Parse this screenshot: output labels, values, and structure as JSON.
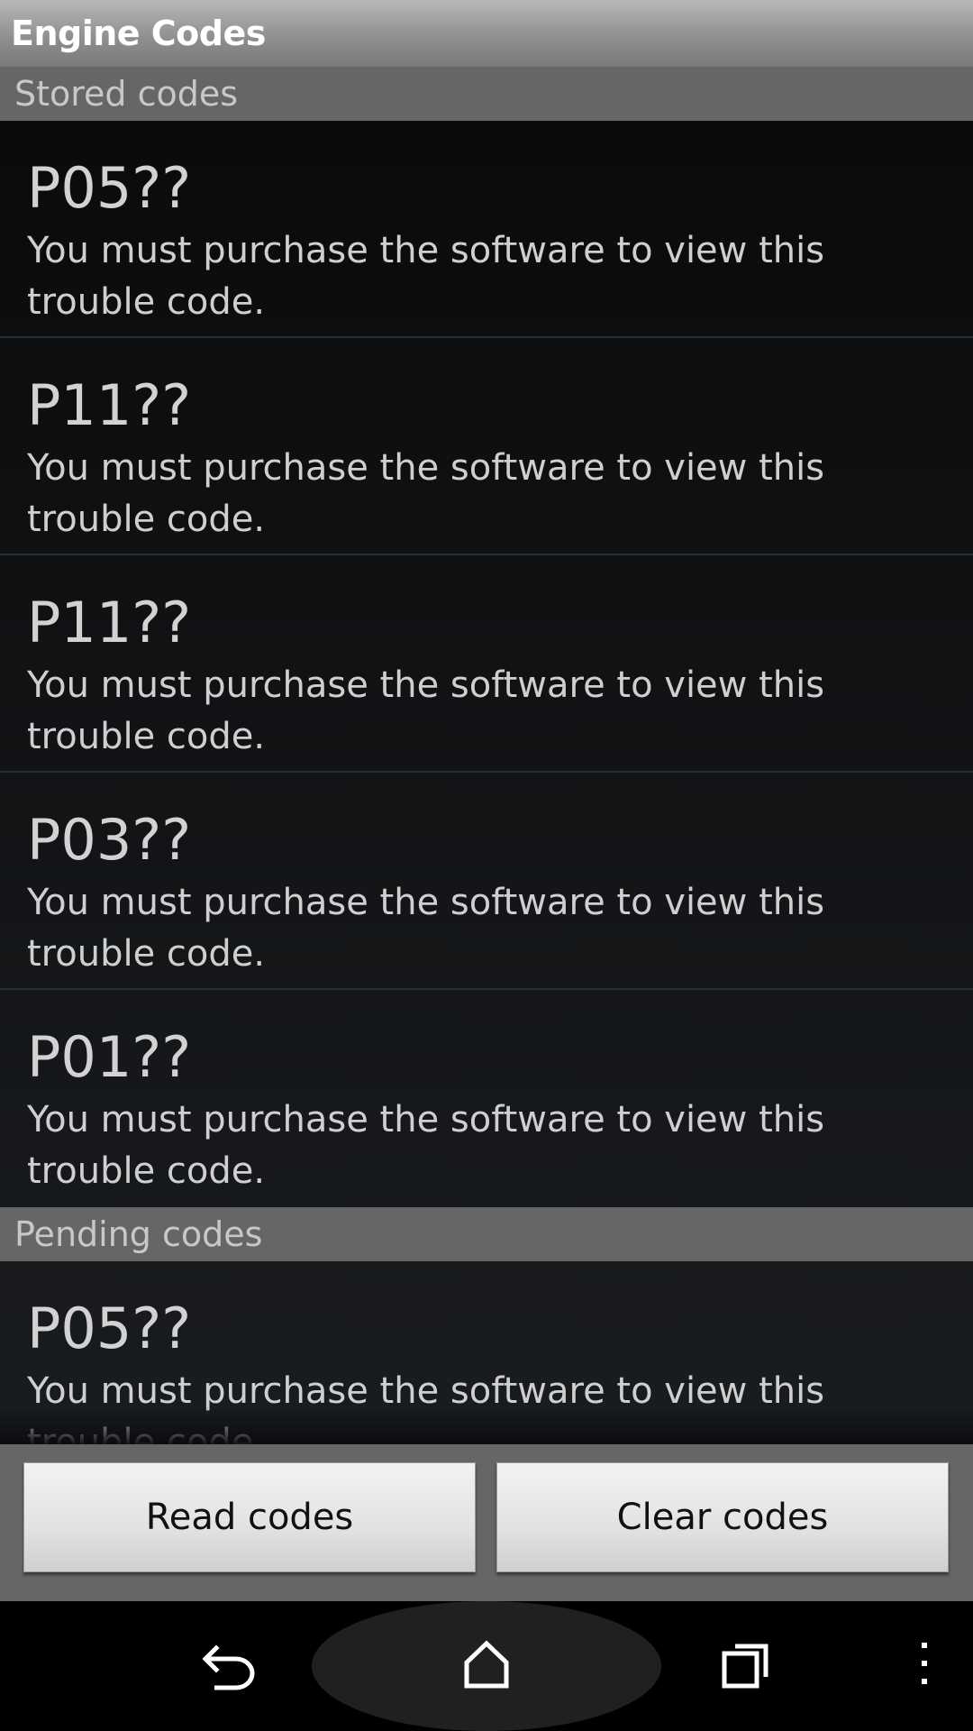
{
  "app": {
    "title": "Engine Codes"
  },
  "sections": {
    "stored": {
      "label": "Stored codes",
      "items": [
        {
          "code": "P05??",
          "description": "You must purchase the software to view this trouble code."
        },
        {
          "code": "P11??",
          "description": "You must purchase the software to view this trouble code."
        },
        {
          "code": "P11??",
          "description": "You must purchase the software to view this trouble code."
        },
        {
          "code": "P03??",
          "description": "You must purchase the software to view this trouble code."
        },
        {
          "code": "P01??",
          "description": "You must purchase the software to view this trouble code."
        }
      ]
    },
    "pending": {
      "label": "Pending codes",
      "items": [
        {
          "code": "P05??",
          "description": "You must purchase the software to view this trouble code."
        }
      ]
    }
  },
  "buttons": {
    "read": "Read codes",
    "clear": "Clear codes"
  },
  "navbar": {
    "back_icon": "back-arrow-icon",
    "home_icon": "home-icon",
    "recents_icon": "recent-apps-icon",
    "menu_icon": "overflow-menu-icon"
  },
  "colors": {
    "titlebar": "#9a9a9a",
    "section_header": "#666666",
    "list_background": "#15171a",
    "button_bar": "#666666"
  }
}
